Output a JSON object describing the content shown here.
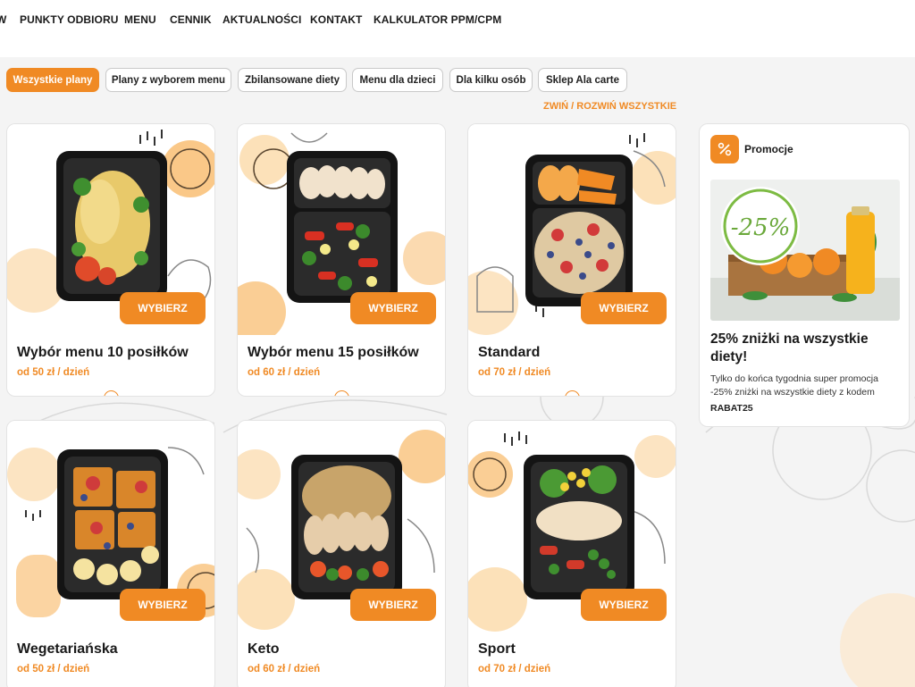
{
  "nav": {
    "items": [
      "W",
      "PUNKTY ODBIORU",
      "MENU",
      "CENNIK",
      "AKTUALNOŚCI",
      "KONTAKT",
      "KALKULATOR PPM/CPM"
    ]
  },
  "filters": {
    "tabs": [
      "Wszystkie plany",
      "Plany z wyborem menu",
      "Zbilansowane diety",
      "Menu dla dzieci",
      "Dla kilku osób",
      "Sklep Ala carte"
    ],
    "active": "Wszystkie plany",
    "toggle_all": "ZWIŃ / ROZWIŃ WSZYSTKIE"
  },
  "cards": [
    {
      "title": "Wybór menu 10 posiłków",
      "price": "od 50 zł / dzień",
      "button": "WYBIERZ",
      "image_icon": "meal-box-pancake-icon"
    },
    {
      "title": "Wybór menu 15 posiłków",
      "price": "od 60 zł / dzień",
      "button": "WYBIERZ",
      "image_icon": "meal-box-chicken-salad-icon"
    },
    {
      "title": "Standard",
      "price": "od 70 zł / dzień",
      "button": "WYBIERZ",
      "image_icon": "meal-box-oatmeal-fruit-icon"
    },
    {
      "title": "Wegetariańska",
      "price": "od 50 zł / dzień",
      "button": "WYBIERZ",
      "image_icon": "meal-box-waffles-icon"
    },
    {
      "title": "Keto",
      "price": "od 60 zł / dzień",
      "button": "WYBIERZ",
      "image_icon": "meal-box-chicken-rice-icon"
    },
    {
      "title": "Sport",
      "price": "od 70 zł / dzień",
      "button": "WYBIERZ",
      "image_icon": "meal-box-chicken-vegetables-icon"
    }
  ],
  "promo": {
    "header": "Promocje",
    "badge_icon": "percent-icon",
    "image_text": "-25%",
    "title": "25% zniżki na wszystkie diety!",
    "description": "Tylko do końca tygodnia super promocja -25% zniżki na wszystkie diety z kodem",
    "code": "RABAT25"
  },
  "colors": {
    "accent": "#f08a24",
    "text": "#1a1a1a",
    "background": "#f4f4f4",
    "card": "#ffffff"
  }
}
